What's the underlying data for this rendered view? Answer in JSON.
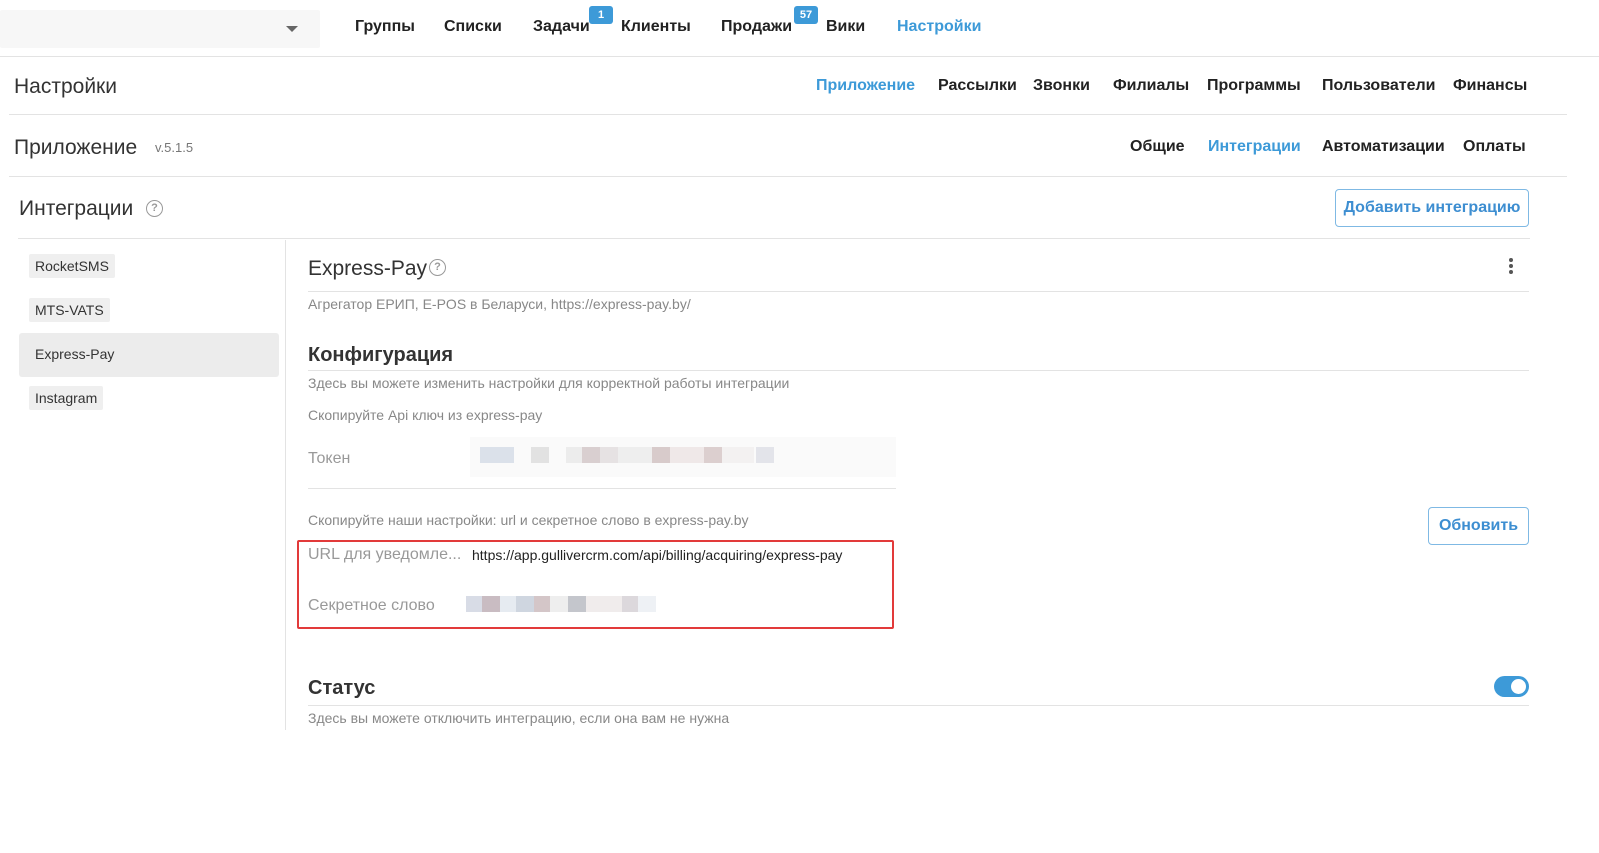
{
  "topnav": {
    "items": [
      {
        "label": "Группы"
      },
      {
        "label": "Списки"
      },
      {
        "label": "Задачи",
        "badge": "1"
      },
      {
        "label": "Клиенты"
      },
      {
        "label": "Продажи",
        "badge": "57"
      },
      {
        "label": "Вики"
      },
      {
        "label": "Настройки",
        "active": true
      }
    ]
  },
  "settings": {
    "title": "Настройки",
    "tabs": [
      "Приложение",
      "Рассылки",
      "Звонки",
      "Филиалы",
      "Программы",
      "Пользователи",
      "Финансы"
    ],
    "active_tab": "Приложение"
  },
  "app": {
    "title": "Приложение",
    "version": "v.5.1.5",
    "tabs": [
      "Общие",
      "Интеграции",
      "Автоматизации",
      "Оплаты"
    ],
    "active_tab": "Интеграции"
  },
  "integrations": {
    "title": "Интеграции",
    "add_button": "Добавить интеграцию",
    "list": [
      "RocketSMS",
      "MTS-VATS",
      "Express-Pay",
      "Instagram"
    ],
    "selected": "Express-Pay"
  },
  "detail": {
    "title": "Express-Pay",
    "description": "Агрегатор ЕРИП, E-POS в Беларуси, https://express-pay.by/",
    "config_title": "Конфигурация",
    "config_desc": "Здесь вы можете изменить настройки для корректной работы интеграции",
    "copy_api_hint": "Скопируйте Api ключ из express-pay",
    "token_label": "Токен",
    "copy_settings_hint": "Скопируйте наши настройки: url и секретное слово в express-pay.by",
    "refresh_button": "Обновить",
    "url_label": "URL для уведомле...",
    "url_value": "https://app.gullivercrm.com/api/billing/acquiring/express-pay",
    "secret_label": "Секретное слово",
    "status_title": "Статус",
    "status_desc": "Здесь вы можете отключить интеграцию, если она вам не нужна",
    "status_enabled": true
  },
  "colors": {
    "accent": "#3d9ad8",
    "highlight_border": "#e23a3a"
  }
}
